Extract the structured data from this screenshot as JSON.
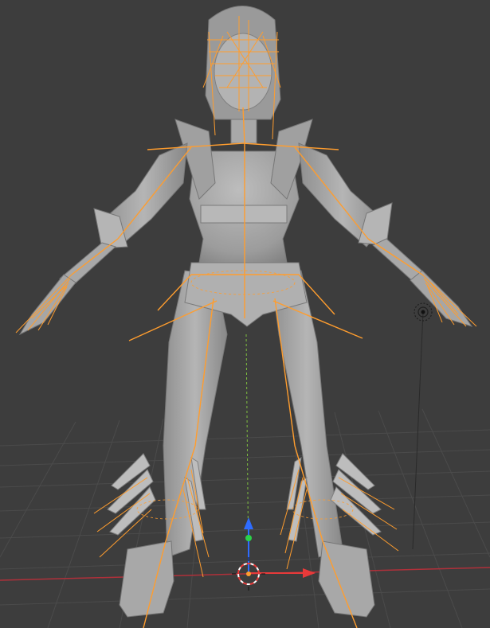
{
  "viewport": {
    "background": "#3d3d3d",
    "grid_color": "#4a4a4a",
    "axis_x_color": "#b0303a",
    "axis_y_color": "#7fbf3f",
    "armature_color": "#ff9d2e",
    "model_color": "#a6a6a6",
    "cursor_icon": "3d-cursor-icon",
    "light_icon": "light-empty-icon",
    "gizmo": {
      "x_arrow_color": "#e83a3a",
      "y_arrow_color": "#2e6cff",
      "z_arrow_color": "#2bd14a"
    }
  }
}
